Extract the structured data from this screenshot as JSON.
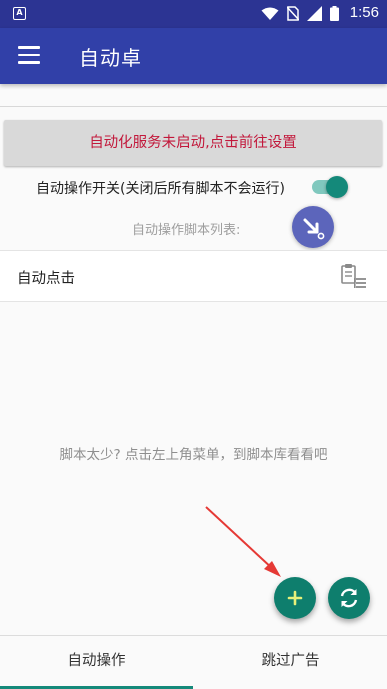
{
  "status_bar": {
    "time": "1:56",
    "icons": [
      "notification-a-icon",
      "wifi-icon",
      "no-sim-icon",
      "signal-icon",
      "battery-icon"
    ]
  },
  "app_bar": {
    "title": "自动卓",
    "menu_icon": "hamburger-menu-icon"
  },
  "service_banner": {
    "text": "自动化服务未启动,点击前往设置",
    "color": "#c2183b"
  },
  "auto_switch": {
    "label": "自动操作开关(关闭后所有脚本不会运行)",
    "on": true
  },
  "script_list": {
    "title": "自动操作脚本列表:",
    "items": [
      {
        "name": "自动点击",
        "action_icon": "edit-list-icon"
      }
    ],
    "empty_hint": "脚本太少? 点击左上角菜单，到脚本库看看吧"
  },
  "fabs": {
    "floating": "pointer-tap-icon",
    "add": "plus-icon",
    "refresh": "refresh-icon"
  },
  "bottom_nav": {
    "tabs": [
      "自动操作",
      "跳过广告"
    ],
    "selected": "自动操作"
  },
  "colors": {
    "status_bar": "#2c3493",
    "app_bar": "#3140a8",
    "accent": "#14897a",
    "annotation_arrow": "#e53935"
  }
}
